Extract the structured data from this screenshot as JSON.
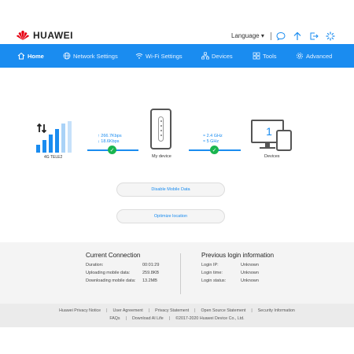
{
  "header": {
    "brand": "HUAWEI",
    "language_label": "Language ▾",
    "icons": [
      "message-icon",
      "upgrade-icon",
      "logout-icon",
      "loading-icon"
    ]
  },
  "nav": {
    "items": [
      {
        "label": "Home",
        "icon": "home-icon",
        "active": true
      },
      {
        "label": "Network Settings",
        "icon": "globe-icon"
      },
      {
        "label": "Wi-Fi Settings",
        "icon": "wifi-icon"
      },
      {
        "label": "Devices",
        "icon": "devices-icon"
      },
      {
        "label": "Tools",
        "icon": "tools-icon"
      },
      {
        "label": "Advanced",
        "icon": "gear-icon"
      }
    ]
  },
  "status": {
    "network_label": "4G  TELE2",
    "upload_rate": "266.7Kbps",
    "download_rate": "18.6Kbps",
    "wifi_band_1": "2.4 GHz",
    "wifi_band_2": "5 GHz",
    "my_device_label": "My device",
    "devices_label": "Devices",
    "devices_count": "1"
  },
  "actions": {
    "disable_mobile_data": "Disable Mobile Data",
    "optimize_location": "Optimize location"
  },
  "current_connection": {
    "title": "Current Connection",
    "rows": [
      {
        "label": "Duration:",
        "value": "00:01:29"
      },
      {
        "label": "Uploading mobile data:",
        "value": "259.8KB"
      },
      {
        "label": "Downloading mobile data:",
        "value": "13.2MB"
      }
    ]
  },
  "previous_login": {
    "title": "Previous login information",
    "rows": [
      {
        "label": "Login IP:",
        "value": "Unknown"
      },
      {
        "label": "Login time:",
        "value": "Unknown"
      },
      {
        "label": "Login status:",
        "value": "Unknown"
      }
    ]
  },
  "footer": {
    "links_row1": [
      "Huawei Privacy Notice",
      "User Agreement",
      "Privacy Statement",
      "Open Source Statement",
      "Security Information"
    ],
    "links_row2": [
      "FAQs",
      "Download AI Life"
    ],
    "copyright": "©2017-2020 Huawei Device Co., Ltd."
  },
  "colors": {
    "accent": "#1a8cf0",
    "success": "#19b54f",
    "brand_red": "#e60012"
  }
}
